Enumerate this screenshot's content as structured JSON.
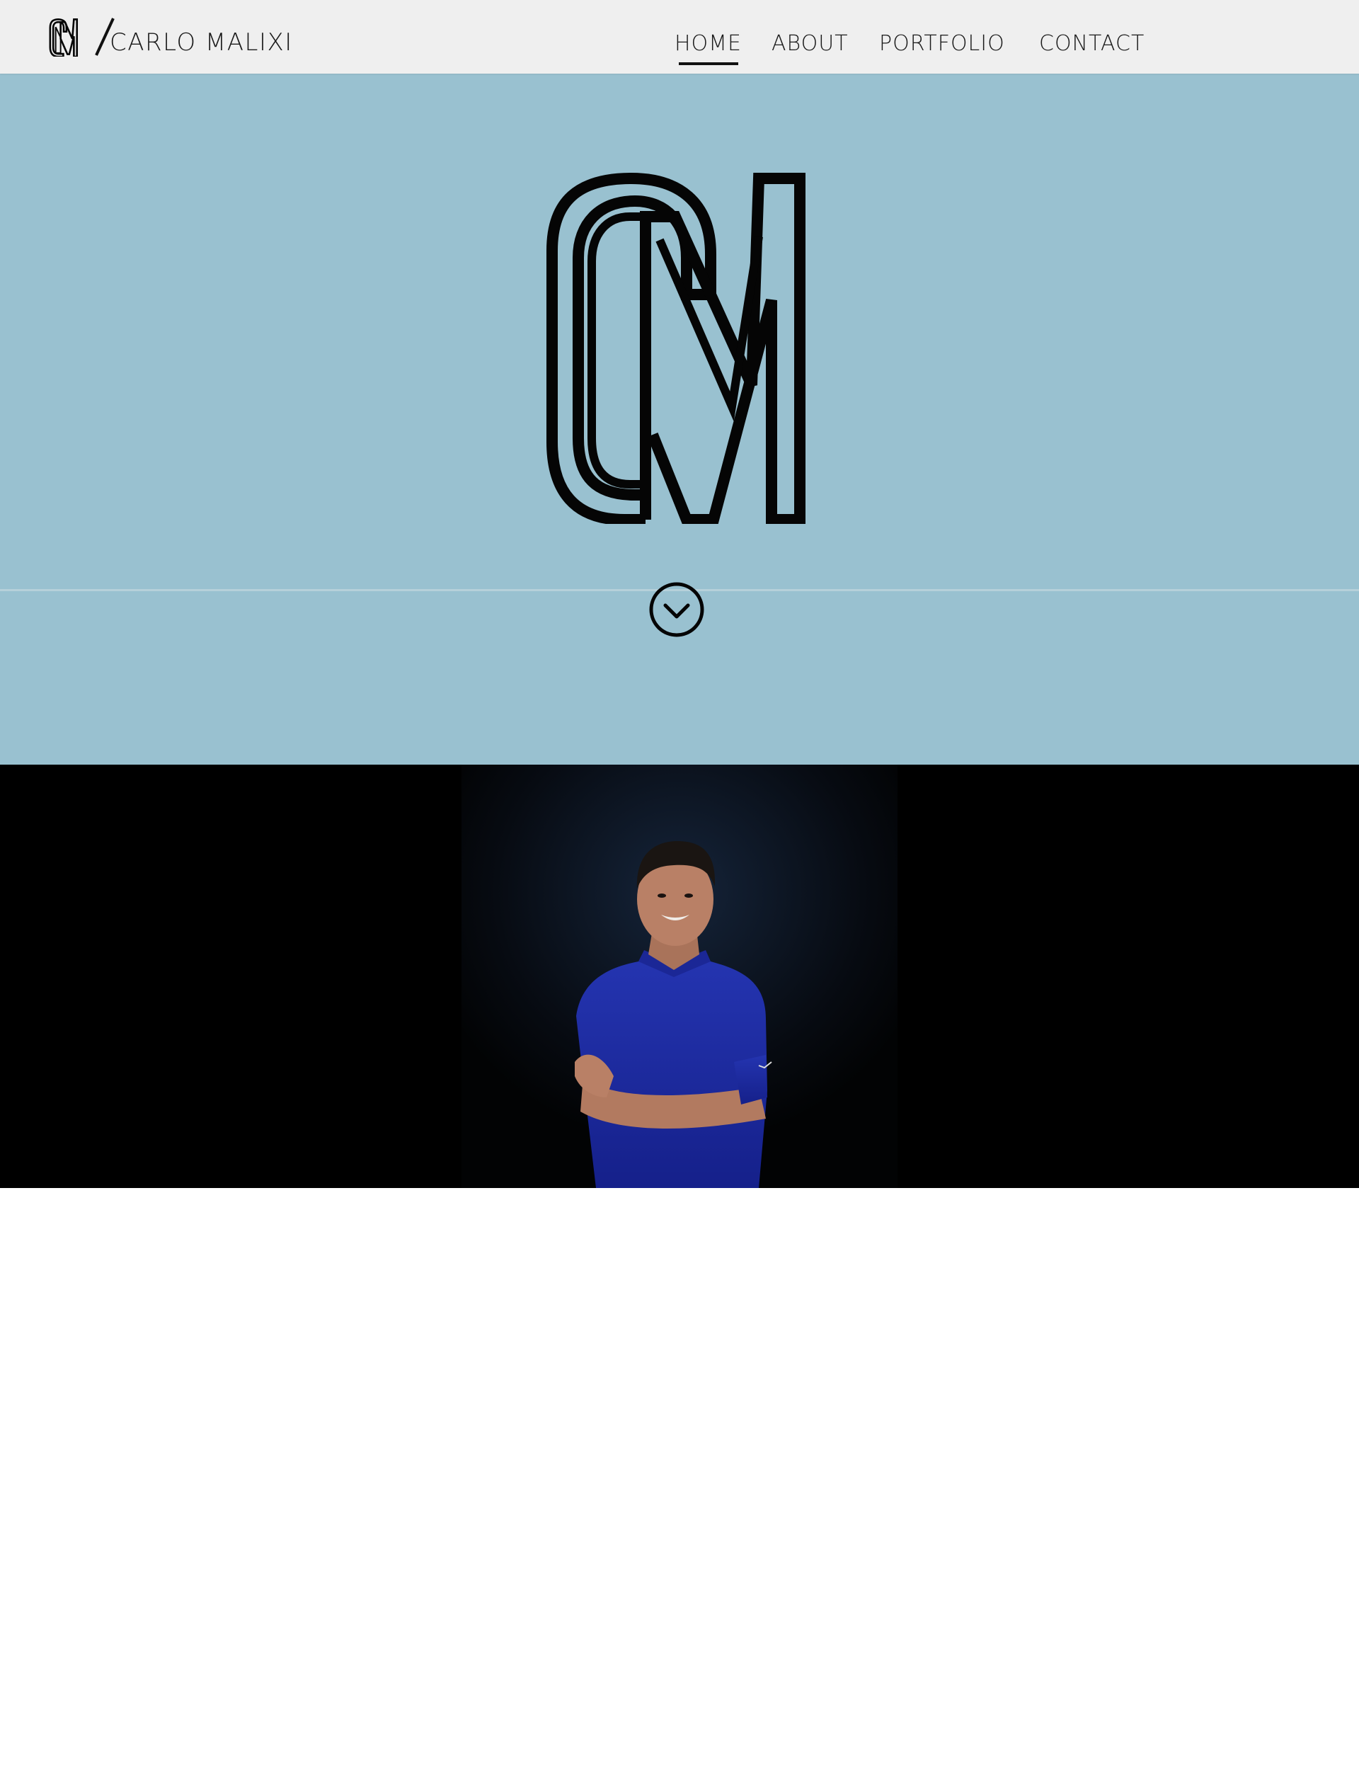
{
  "colors": {
    "header_bg": "#efefef",
    "hero_bg": "#99c1d0",
    "photo_band_bg": "#000000",
    "page_bg": "#ffffff",
    "text": "#1a1a1a",
    "monogram": "#050505",
    "shirt": "#1e2d9e"
  },
  "header": {
    "logo_icon": "cm-monogram-icon",
    "brand_name": "CARLO MALIXI",
    "nav": [
      {
        "label": "HOME",
        "active": true
      },
      {
        "label": "ABOUT",
        "active": false
      },
      {
        "label": "PORTFOLIO",
        "active": false
      },
      {
        "label": "CONTACT",
        "active": false
      }
    ]
  },
  "hero": {
    "monogram_icon": "cm-monogram-icon",
    "scroll_icon": "chevron-down-circle-icon"
  },
  "photo_band": {
    "portrait_icon": "portrait-photo"
  }
}
